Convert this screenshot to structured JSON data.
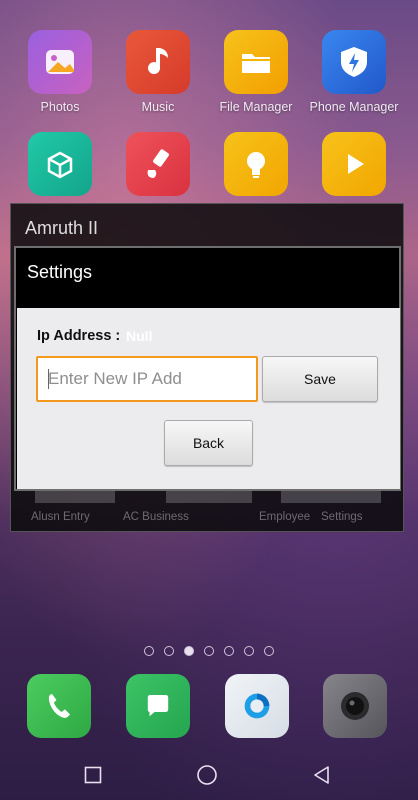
{
  "home_apps": [
    {
      "label": "Photos",
      "icon": "photos-icon",
      "color": "#8a57d6"
    },
    {
      "label": "Music",
      "icon": "music-note-icon",
      "color": "#e2482e"
    },
    {
      "label": "File Manager",
      "icon": "folder-icon",
      "color": "#f4b400"
    },
    {
      "label": "Phone Manager",
      "icon": "shield-icon",
      "color": "#2f74e0"
    },
    {
      "label": "",
      "icon": "3d-cube-icon",
      "color": "#1ebda0"
    },
    {
      "label": "",
      "icon": "brush-icon",
      "color": "#e7444e"
    },
    {
      "label": "",
      "icon": "lightbulb-icon",
      "color": "#f2b100"
    },
    {
      "label": "",
      "icon": "play-icon",
      "color": "#f2b100"
    }
  ],
  "background_window": {
    "title": "Amruth II",
    "obscured_labels": [
      "Alusn Entry",
      "AC Business",
      "Employee",
      "Settings"
    ]
  },
  "dialog": {
    "title": "Settings",
    "ip_label": "Ip Address :",
    "ip_value": "Null",
    "ip_input": {
      "value": "",
      "placeholder": "Enter New IP Add"
    },
    "save_label": "Save",
    "back_label": "Back",
    "accent_color": "#f39a1e"
  },
  "page_indicator": {
    "count": 7,
    "active": 3
  },
  "dock": [
    {
      "icon": "phone-icon",
      "color": "#3dbb53"
    },
    {
      "icon": "message-icon",
      "color": "#2fb45a"
    },
    {
      "icon": "browser-icon",
      "color": "#e9eef3"
    },
    {
      "icon": "camera-icon",
      "color": "#707076"
    }
  ],
  "nav_bar": [
    "recents-icon",
    "home-icon",
    "back-icon"
  ]
}
